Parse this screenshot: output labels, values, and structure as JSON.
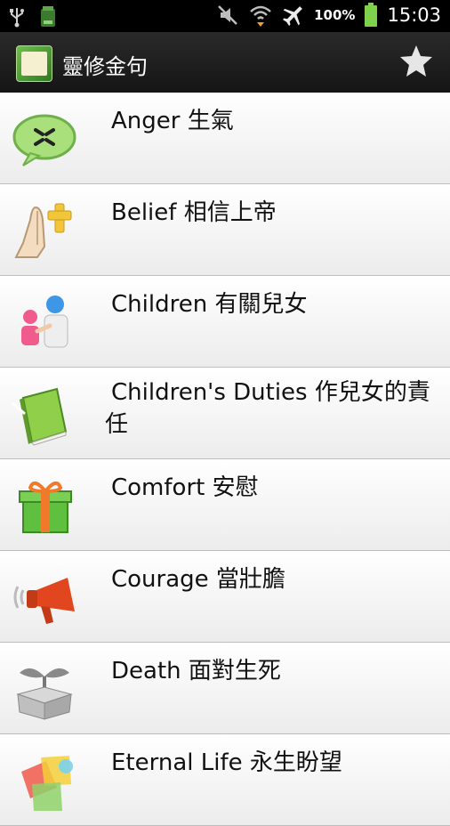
{
  "status_bar": {
    "battery_percent": "100%",
    "time": "15:03",
    "icons": [
      "usb-icon",
      "storage-icon",
      "mute-icon",
      "wifi-icon",
      "airplane-mode-icon",
      "battery-icon"
    ]
  },
  "action_bar": {
    "title": "靈修金句",
    "favorites_icon": "star-icon"
  },
  "topics": [
    {
      "label": "Anger 生氣",
      "icon": "angry-speech-bubble-icon"
    },
    {
      "label": "Belief 相信上帝",
      "icon": "praying-hands-cross-icon"
    },
    {
      "label": "Children 有關兒女",
      "icon": "parent-child-icon"
    },
    {
      "label": "Children's Duties 作兒女的責任",
      "icon": "green-book-icon"
    },
    {
      "label": "Comfort 安慰",
      "icon": "gift-box-icon"
    },
    {
      "label": "Courage 當壯膽",
      "icon": "megaphone-icon"
    },
    {
      "label": "Death 面對生死",
      "icon": "box-sprout-icon"
    },
    {
      "label": "Eternal Life 永生盼望",
      "icon": "glowing-pieces-icon"
    }
  ],
  "colors": {
    "status_bar_bg": "#000000",
    "action_bar_bg": "#1e1e1e",
    "list_item_bg": "#f6f6f6",
    "divider": "#bdbdbd"
  }
}
